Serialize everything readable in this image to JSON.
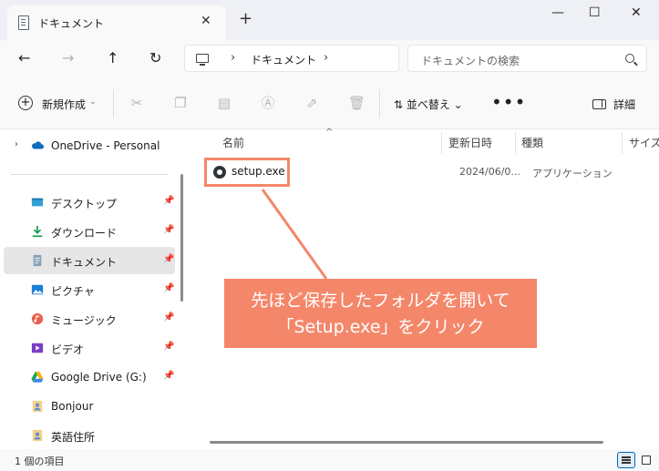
{
  "window": {
    "tab_title": "ドキュメント",
    "tab_close": "✕",
    "new_tab": "+",
    "minimize": "—",
    "maximize": "☐",
    "close": "✕"
  },
  "navigation": {
    "back": "←",
    "forward": "→",
    "up": "↑",
    "refresh": "↻",
    "address_separator": "›",
    "address_crumb": "ドキュメント",
    "address_trailing": "›",
    "search_placeholder": "ドキュメントの検索"
  },
  "toolbar": {
    "new_label": "新規作成",
    "new_chevron": "⌄",
    "sort_label": "⇅  並べ替え  ⌄",
    "more_label": "•••",
    "details_label": "詳細",
    "icons": [
      "cut-icon",
      "copy-icon",
      "paste-icon",
      "rename-icon",
      "share-icon",
      "delete-icon"
    ]
  },
  "sidebar": {
    "expand_arrow": "›",
    "pin_glyph": "📌",
    "items": [
      {
        "label": "OneDrive - Personal",
        "icon": "cloud-icon"
      },
      {
        "label": "デスクトップ",
        "icon": "desktop-icon",
        "pinned": true
      },
      {
        "label": "ダウンロード",
        "icon": "download-icon",
        "pinned": true
      },
      {
        "label": "ドキュメント",
        "icon": "documents-icon",
        "pinned": true,
        "selected": true
      },
      {
        "label": "ピクチャ",
        "icon": "pictures-icon",
        "pinned": true
      },
      {
        "label": "ミュージック",
        "icon": "music-icon",
        "pinned": true
      },
      {
        "label": "ビデオ",
        "icon": "videos-icon",
        "pinned": true
      },
      {
        "label": "Google Drive (G:)",
        "icon": "google-drive-icon",
        "pinned": true
      },
      {
        "label": "Bonjour",
        "icon": "folder-user-icon"
      },
      {
        "label": "英語住所",
        "icon": "folder-user-icon"
      }
    ]
  },
  "columns": {
    "sort_indicator": "^",
    "name": "名前",
    "modified": "更新日時",
    "type": "種類",
    "size": "サイズ"
  },
  "files": [
    {
      "name": "setup.exe",
      "modified": "2024/06/0...",
      "type": "アプリケーション",
      "icon": "setup-app-icon"
    }
  ],
  "callout": {
    "line1": "先ほど保存したフォルダを開いて",
    "line2": "「Setup.exe」をクリック",
    "color": "#f4876a"
  },
  "status": {
    "item_count": "1 個の項目"
  },
  "colors": {
    "accent": "#0067c0",
    "annotation": "#f4876a"
  }
}
